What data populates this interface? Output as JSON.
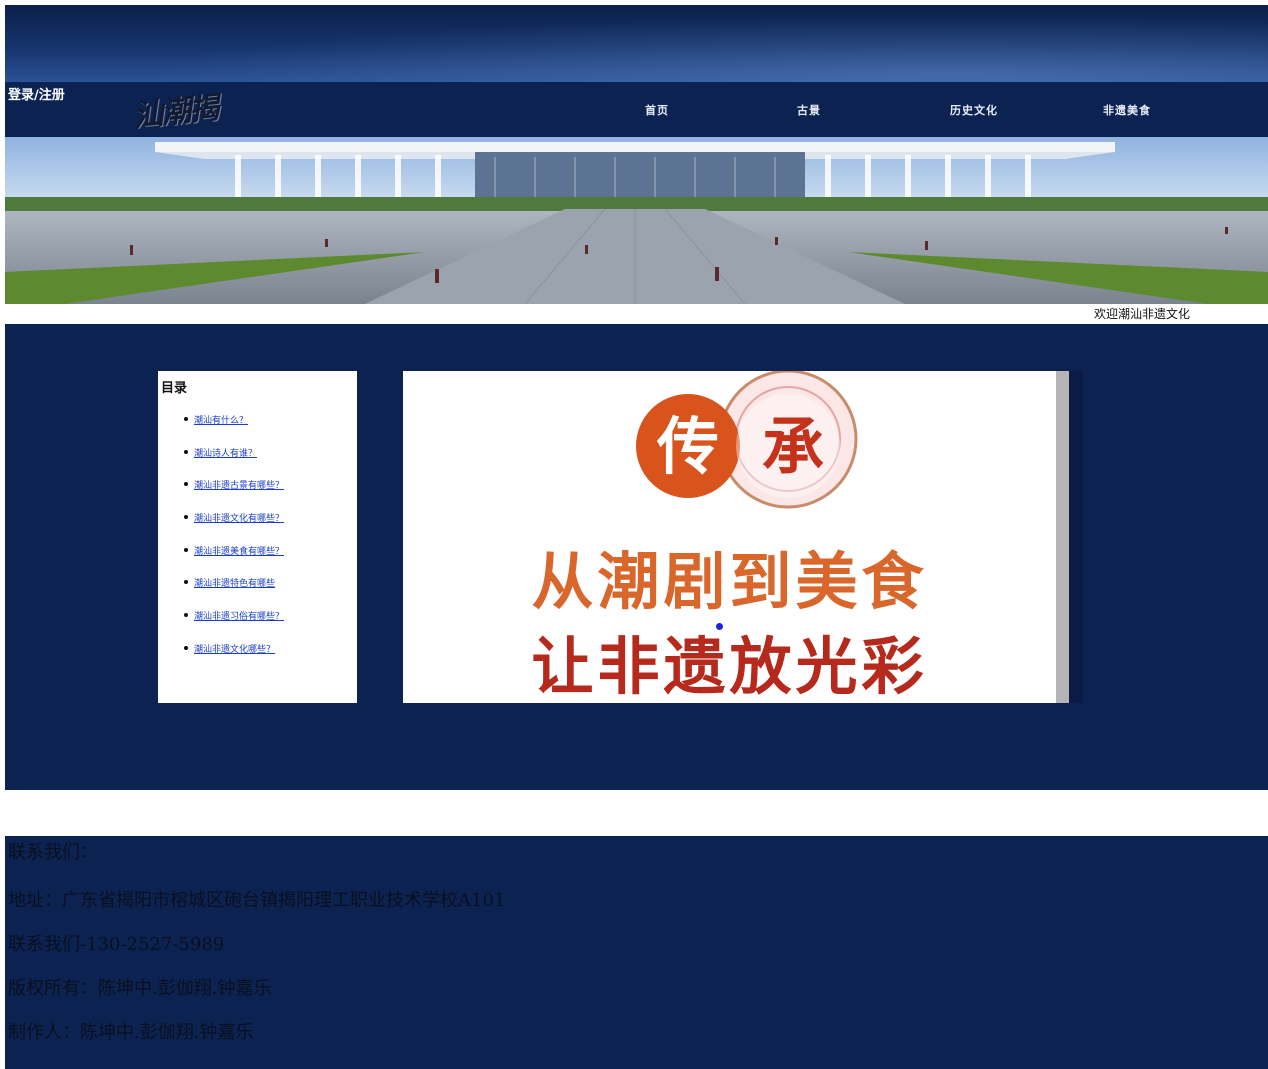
{
  "header": {
    "login_label": "登录/注册",
    "logo_text": "汕潮揭",
    "nav": [
      "首页",
      "古景",
      "历史文化",
      "非遗美食"
    ]
  },
  "welcome_text": "欢迎潮汕非遗文化",
  "toc": {
    "title": "目录",
    "items": [
      "潮汕有什么？",
      "潮汕诗人有谁？",
      "潮汕非遗古景有哪些？",
      "潮汕非遗文化有哪些？",
      "潮汕非遗美食有哪些？",
      "潮汕非遗特色有哪些",
      "潮汕非遗习俗有哪些？",
      "潮汕非遗文化哪些？"
    ]
  },
  "poster": {
    "badge_left": "传",
    "badge_right": "承",
    "line1": "从潮剧到美食",
    "line2": "让非遗放光彩"
  },
  "footer": {
    "contact_heading": "联系我们：",
    "address": "地址：广东省揭阳市榕城区砲台镇揭阳理工职业技术学校A101",
    "phone": "联系我们-130-2527-5989",
    "copyright": "版权所有：陈坤中.彭伽翔.钟嘉乐",
    "author": "制作人：陈坤中.彭伽翔.钟嘉乐"
  },
  "colors": {
    "navy": "#0c2352",
    "poster_orange": "#d9662a",
    "poster_red": "#b52a1c",
    "link_blue": "#1a3ec8"
  }
}
